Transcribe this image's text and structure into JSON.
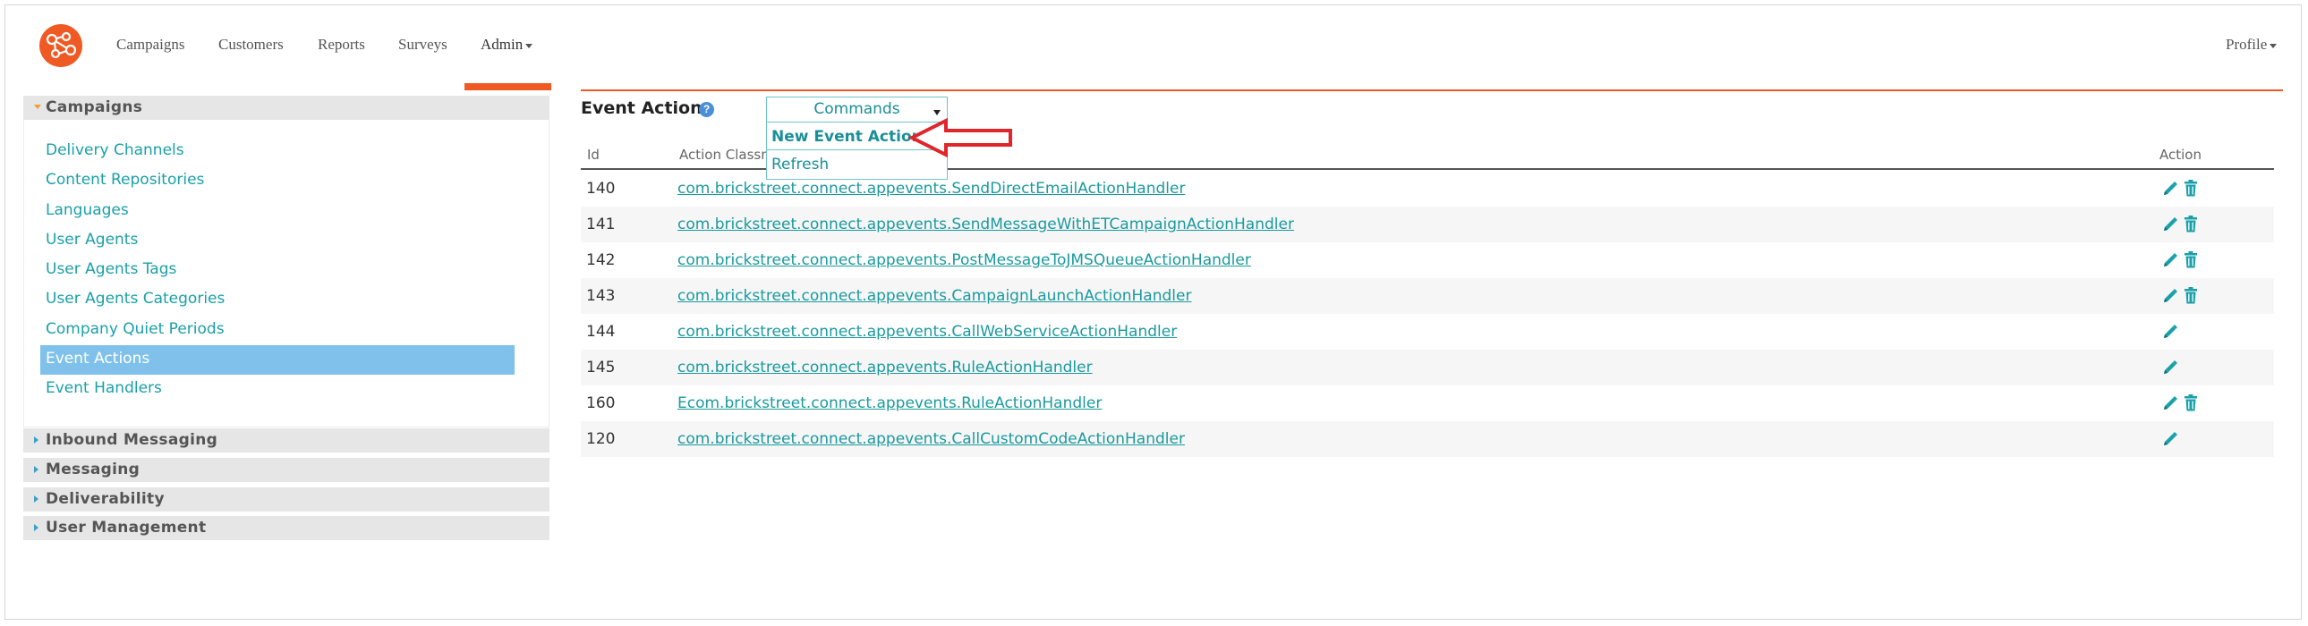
{
  "nav": {
    "items": [
      {
        "label": "Campaigns"
      },
      {
        "label": "Customers"
      },
      {
        "label": "Reports"
      },
      {
        "label": "Surveys"
      },
      {
        "label": "Admin"
      }
    ],
    "profile_label": "Profile"
  },
  "sidebar": {
    "sections": [
      {
        "label": "Campaigns",
        "expanded": true
      },
      {
        "label": "Inbound Messaging",
        "expanded": false
      },
      {
        "label": "Messaging",
        "expanded": false
      },
      {
        "label": "Deliverability",
        "expanded": false
      },
      {
        "label": "User Management",
        "expanded": false
      }
    ],
    "campaign_items": [
      {
        "label": "Delivery Channels"
      },
      {
        "label": "Content Repositories"
      },
      {
        "label": "Languages"
      },
      {
        "label": "User Agents"
      },
      {
        "label": "User Agents Tags"
      },
      {
        "label": "User Agents Categories"
      },
      {
        "label": "Company Quiet Periods"
      },
      {
        "label": "Event Actions",
        "selected": true
      },
      {
        "label": "Event Handlers"
      }
    ]
  },
  "main": {
    "title": "Event Actions",
    "help_icon": "?",
    "commands": {
      "label": "Commands",
      "options": [
        "New Event Action",
        "Refresh"
      ]
    },
    "table": {
      "headers": {
        "id": "Id",
        "classname": "Action Classna",
        "action": "Action"
      },
      "rows": [
        {
          "id": "140",
          "classname": "com.brickstreet.connect.appevents.SendDirectEmailActionHandler",
          "deletable": true
        },
        {
          "id": "141",
          "classname": "com.brickstreet.connect.appevents.SendMessageWithETCampaignActionHandler",
          "deletable": true
        },
        {
          "id": "142",
          "classname": "com.brickstreet.connect.appevents.PostMessageToJMSQueueActionHandler",
          "deletable": true
        },
        {
          "id": "143",
          "classname": "com.brickstreet.connect.appevents.CampaignLaunchActionHandler",
          "deletable": true
        },
        {
          "id": "144",
          "classname": "com.brickstreet.connect.appevents.CallWebServiceActionHandler",
          "deletable": false
        },
        {
          "id": "145",
          "classname": "com.brickstreet.connect.appevents.RuleActionHandler",
          "deletable": false
        },
        {
          "id": "160",
          "classname": "Ecom.brickstreet.connect.appevents.RuleActionHandler",
          "deletable": true
        },
        {
          "id": "120",
          "classname": "com.brickstreet.connect.appevents.CallCustomCodeActionHandler",
          "deletable": false
        }
      ]
    }
  },
  "colors": {
    "accent": "#ef5a24",
    "link": "#1a9a9f",
    "selected_bg": "#7fc1eb",
    "annotation": "#e0262b"
  },
  "icons": {
    "logo": "network-logo-icon",
    "edit": "pencil-icon",
    "delete": "trash-icon",
    "annotation": "red-arrow-icon"
  }
}
